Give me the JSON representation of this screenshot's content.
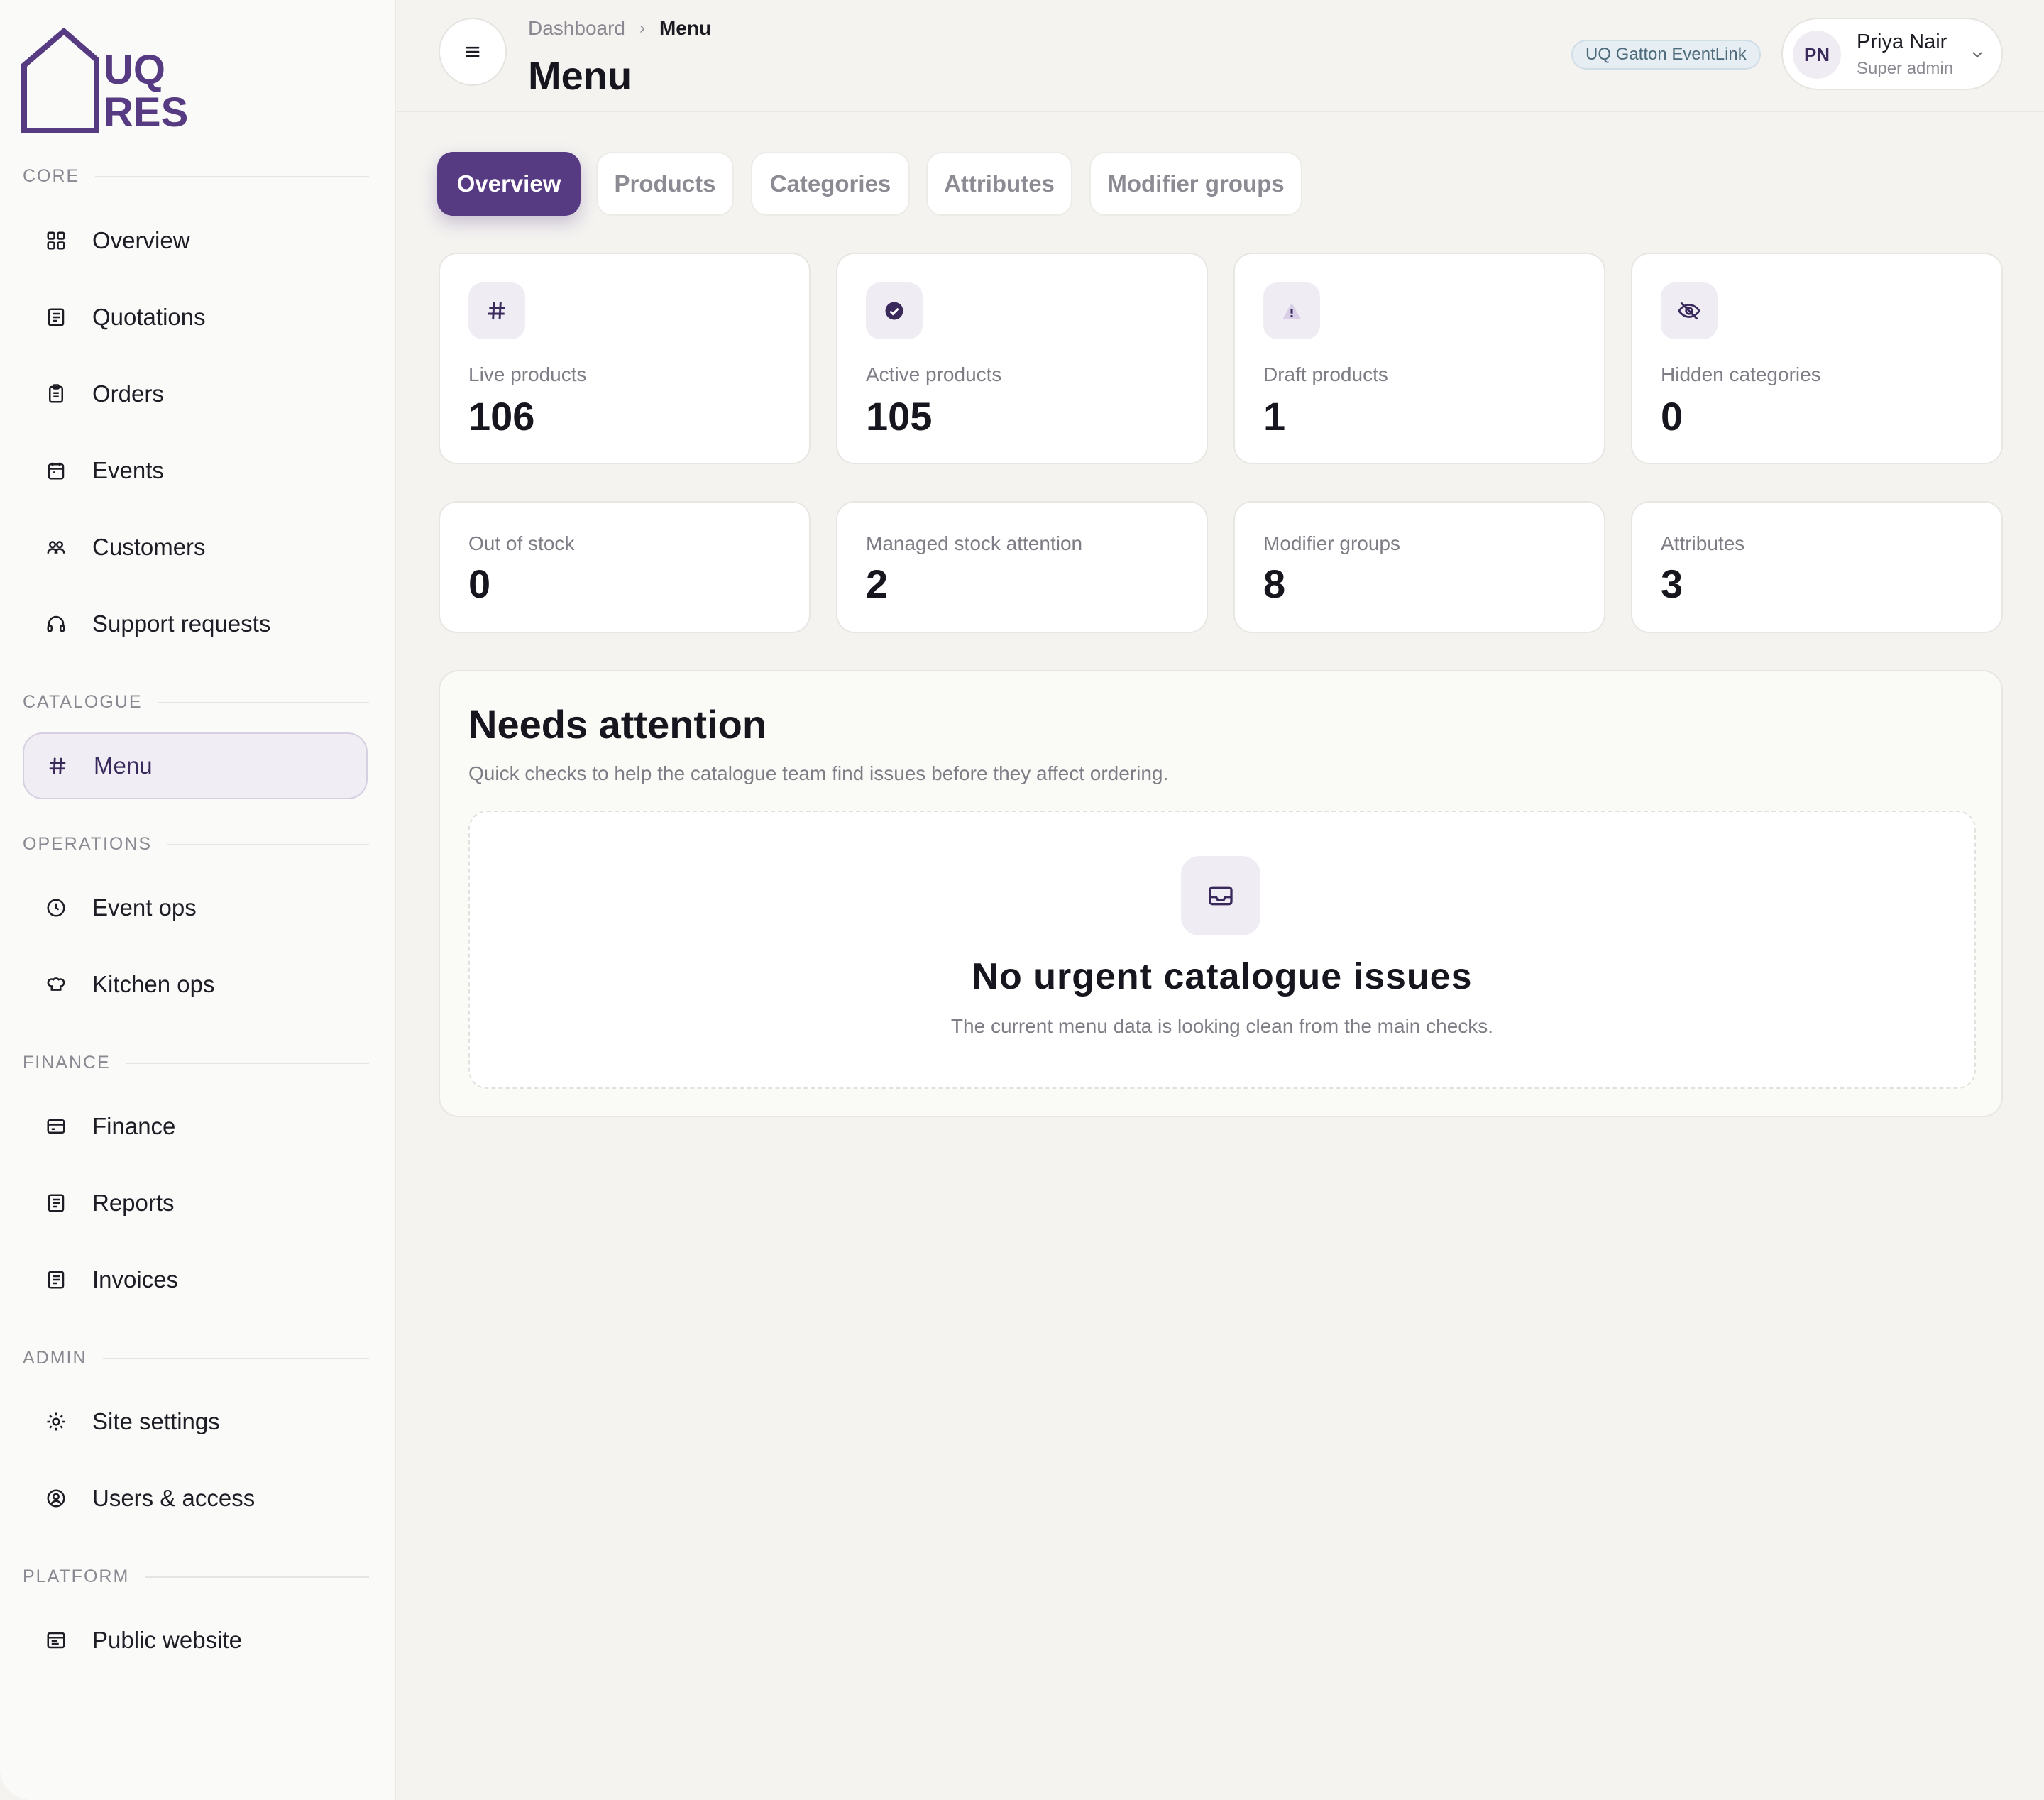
{
  "brand": {
    "logo_line1": "UQ",
    "logo_line2": "RES",
    "accent": "#563a82"
  },
  "sidebar": {
    "sections": [
      {
        "label": "CORE"
      },
      {
        "label": "CATALOGUE"
      },
      {
        "label": "OPERATIONS"
      },
      {
        "label": "FINANCE"
      },
      {
        "label": "ADMIN"
      },
      {
        "label": "PLATFORM"
      }
    ],
    "items": [
      {
        "label": "Overview",
        "icon": "grid-icon"
      },
      {
        "label": "Quotations",
        "icon": "document-icon"
      },
      {
        "label": "Orders",
        "icon": "clipboard-icon"
      },
      {
        "label": "Events",
        "icon": "calendar-icon"
      },
      {
        "label": "Customers",
        "icon": "users-icon"
      },
      {
        "label": "Support requests",
        "icon": "headset-icon"
      },
      {
        "label": "Menu",
        "icon": "hash-icon",
        "active": true
      },
      {
        "label": "Event ops",
        "icon": "clock-icon"
      },
      {
        "label": "Kitchen ops",
        "icon": "chef-hat-icon"
      },
      {
        "label": "Finance",
        "icon": "credit-card-icon"
      },
      {
        "label": "Reports",
        "icon": "document-icon"
      },
      {
        "label": "Invoices",
        "icon": "document-icon"
      },
      {
        "label": "Site settings",
        "icon": "gear-icon"
      },
      {
        "label": "Users & access",
        "icon": "user-circle-icon"
      },
      {
        "label": "Public website",
        "icon": "browser-icon"
      }
    ]
  },
  "header": {
    "breadcrumb": {
      "root": "Dashboard",
      "current": "Menu"
    },
    "title": "Menu",
    "tenant": "UQ Gatton EventLink",
    "user": {
      "initials": "PN",
      "name": "Priya Nair",
      "role": "Super admin"
    }
  },
  "tabs": [
    {
      "label": "Overview",
      "active": true
    },
    {
      "label": "Products"
    },
    {
      "label": "Categories"
    },
    {
      "label": "Attributes"
    },
    {
      "label": "Modifier groups"
    }
  ],
  "stats_primary": [
    {
      "label": "Live products",
      "value": "106",
      "icon": "hash-icon"
    },
    {
      "label": "Active products",
      "value": "105",
      "icon": "check-circle-icon"
    },
    {
      "label": "Draft products",
      "value": "1",
      "icon": "warning-icon"
    },
    {
      "label": "Hidden categories",
      "value": "0",
      "icon": "eye-off-icon"
    }
  ],
  "stats_secondary": [
    {
      "label": "Out of stock",
      "value": "0"
    },
    {
      "label": "Managed stock attention",
      "value": "2"
    },
    {
      "label": "Modifier groups",
      "value": "8"
    },
    {
      "label": "Attributes",
      "value": "3"
    }
  ],
  "attention": {
    "title": "Needs attention",
    "subtitle": "Quick checks to help the catalogue team find issues before they affect ordering.",
    "empty_title": "No urgent catalogue issues",
    "empty_subtitle": "The current menu data is looking clean from the main checks.",
    "empty_icon": "inbox-icon"
  }
}
